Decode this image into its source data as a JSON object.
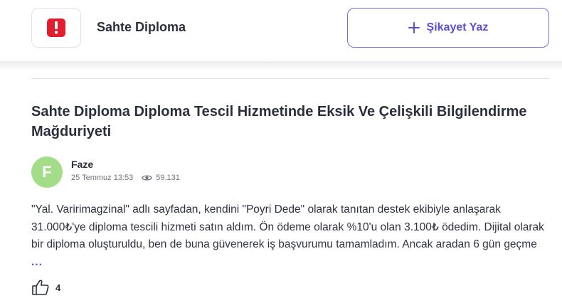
{
  "header": {
    "brand_name": "Sahte Diploma",
    "complain_button_label": "Şikayet Yaz"
  },
  "complaint": {
    "title": "Sahte Diploma Diploma Tescil Hizmetinde Eksik Ve Çelişkili Bilgilendirme Mağduriyeti",
    "author": {
      "initial": "F",
      "name": "Faze",
      "avatar_color": "#a3dd8a"
    },
    "date": "25 Temmuz 13:53",
    "views": "59.131",
    "body": "\"Yal. Varirimagzinal\" adlı sayfadan, kendini \"Poyri Dede\" olarak tanıtan destek ekibiyle anlaşarak 31.000₺'ye diploma tescili hizmeti satın aldım. Ön ödeme olarak %10'u olan 3.100₺ ödedim. Dijital olarak bir diploma oluşturuldu, ben de buna güvenerek iş başvurumu tamamladım. Ancak aradan 6 gün geçme",
    "more_label": "...",
    "like_count": "4"
  },
  "colors": {
    "accent": "#5b4fd6",
    "brand_red": "#e11d2e"
  },
  "icons": {
    "brand": "exclamation-icon",
    "complain": "plus-icon",
    "views": "eye-icon",
    "like": "thumbs-up-icon"
  }
}
